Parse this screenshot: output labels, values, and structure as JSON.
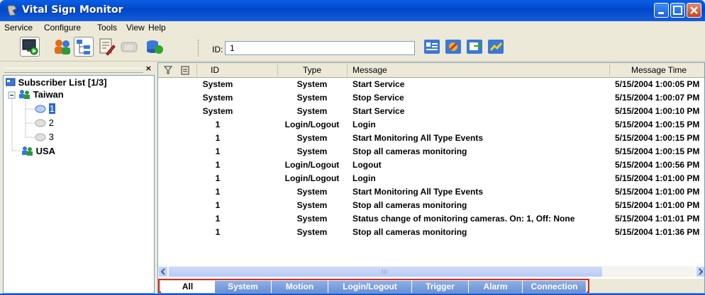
{
  "window": {
    "title": "Vital Sign Monitor"
  },
  "menu": [
    "Service",
    "Configure",
    "Tools",
    "View",
    "Help"
  ],
  "toolbar": {
    "id_label": "ID:",
    "id_value": "1"
  },
  "tree": {
    "panel_close": "×",
    "root": "Subscriber List [1/3]",
    "groups": [
      {
        "name": "Taiwan",
        "children": [
          "1",
          "2",
          "3"
        ]
      },
      {
        "name": "USA"
      }
    ]
  },
  "grid": {
    "columns": [
      "ID",
      "Type",
      "Message",
      "Message Time"
    ],
    "rows": [
      {
        "id": "System",
        "type": "System",
        "message": "Start Service",
        "time": "5/15/2004 1:00:05 PM"
      },
      {
        "id": "System",
        "type": "System",
        "message": "Stop Service",
        "time": "5/15/2004 1:00:07 PM"
      },
      {
        "id": "System",
        "type": "System",
        "message": "Start Service",
        "time": "5/15/2004 1:00:10 PM"
      },
      {
        "id": "1",
        "type": "Login/Logout",
        "message": "Login",
        "time": "5/15/2004 1:00:15 PM"
      },
      {
        "id": "1",
        "type": "System",
        "message": "Start Monitoring All Type Events",
        "time": "5/15/2004 1:00:15 PM"
      },
      {
        "id": "1",
        "type": "System",
        "message": "Stop all cameras monitoring",
        "time": "5/15/2004 1:00:15 PM"
      },
      {
        "id": "1",
        "type": "Login/Logout",
        "message": "Logout",
        "time": "5/15/2004 1:00:56 PM"
      },
      {
        "id": "1",
        "type": "Login/Logout",
        "message": "Login",
        "time": "5/15/2004 1:01:00 PM"
      },
      {
        "id": "1",
        "type": "System",
        "message": "Start Monitoring All Type Events",
        "time": "5/15/2004 1:01:00 PM"
      },
      {
        "id": "1",
        "type": "System",
        "message": "Stop all cameras monitoring",
        "time": "5/15/2004 1:01:00 PM"
      },
      {
        "id": "1",
        "type": "System",
        "message": "Status change of monitoring cameras. On: 1, Off: None",
        "time": "5/15/2004 1:01:01 PM"
      },
      {
        "id": "1",
        "type": "System",
        "message": "Stop all cameras monitoring",
        "time": "5/15/2004 1:01:36 PM"
      }
    ]
  },
  "tabs": [
    "All",
    "System",
    "Motion",
    "Login/Logout",
    "Trigger",
    "Alarm",
    "Connection"
  ],
  "active_tab": "All",
  "colors": {
    "titlebar": "#0047c8",
    "tab_inactive": "#6990d6",
    "tab_outline": "#d32a2a",
    "selection": "#316ac5"
  }
}
